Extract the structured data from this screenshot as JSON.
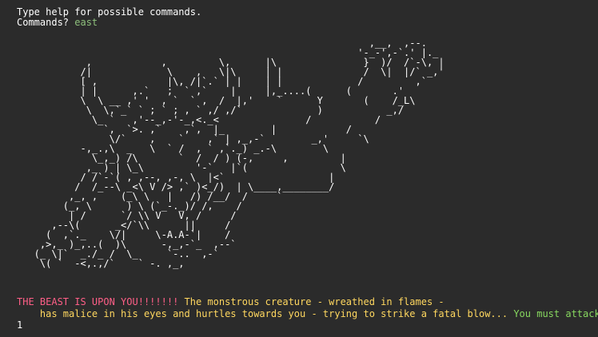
{
  "terminal": {
    "help_text": "Type help for possible commands.",
    "prompt_label": "Commands? ",
    "prompt_value": "east",
    "ascii_art": "                                                             ,__,  ,--.\n                                                           '-_-',-`.' |._\n            ,            ,         \\,      |\\               }  )/  /`-\\, |\n           /|             \\    ,   \\|\\     | |              /  \\|  |/` _,'\n           [ ,            |\\, /|`.` | |    | |             /         ,`\n           | |      ,.`   ;  ` ,`    |     |,_....(      (       .'\n           \\  \\ __ ,' '  , `  ` ,  /  |,'    `      Y       (    /_L\\\n            \\  \\,`_` ` ; ` ; , ` ,/ ,/`             )           _,/\n             \\_ `   ,'--_,-'-_,<._<               /           /\n               `,  `>. ,`    ,`,  |_        |            /\n                \\/`    ,    `    ,` | ,_,-`        _,'     `\\\n           -,_.,\\  _   \\  ` /  , ` ,`._) _.-\\        \\\n             \\_,_) /\\       `  /  / ) (-,     ,         |\n            ,_ ) | \\_\\         '-`   |`(                \\\n           / /`-`( , ,--, ,-, \\  |<`                  |\n          /  /_--\\ _<\\ V /> ,` )<_/)  | \\____,________/\n         ,_, ,    (_\\ \\   |   /) /__/  /     `\n        (_, \\      ) \\ (`_-._)/ /,    /\n         | /      `/ \\\\ V   V, /     /\n      ,--\\(      _</`\\\\      ||     /\n     (  ,`._    \\/|     \\-A.A-`|    /\n    ,>,_ )_,..(  )\\      -,_,-`_  ,--`\n   (_ \\|`  _./_ /  \\_     `-..  ,-`\n    \\( `  -<,.,/`    ` -. ,_,",
    "beast_warning": "THE BEAST IS UPON YOU!!!!!!!",
    "narration_line1": " The monstrous creature - wreathed in flames -",
    "narration_line2": "    has malice in his eyes and hurtles towards you - trying to strike a fatal blow...",
    "attack_prompt": " You must attack!!",
    "input_echo": "1"
  },
  "colors": {
    "background": "#2b2b2b",
    "warning": "#ff5f87",
    "narration": "#ffd75f",
    "command": "#87d75f"
  }
}
